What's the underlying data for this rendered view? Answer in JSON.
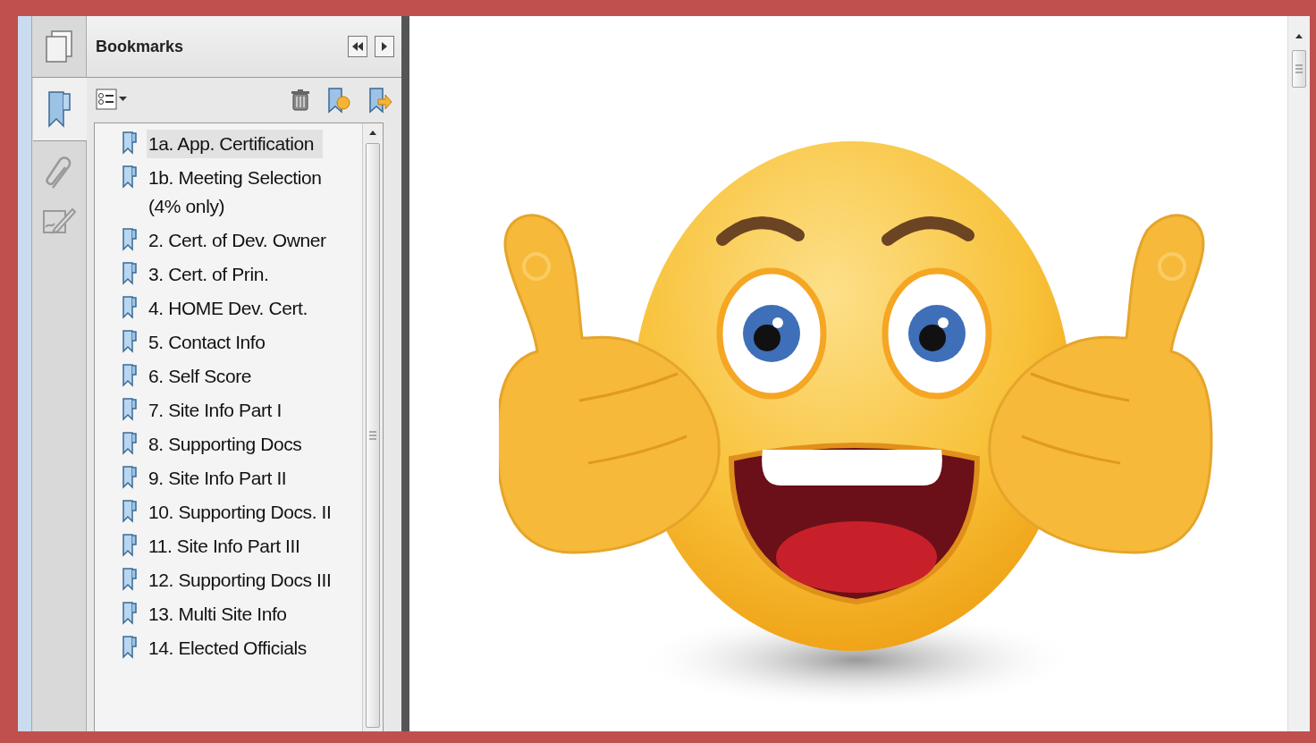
{
  "panel": {
    "title": "Bookmarks"
  },
  "bookmarks": [
    {
      "label": "1a. App. Certification",
      "selected": true
    },
    {
      "label": "1b. Meeting Selection (4% only)",
      "selected": false
    },
    {
      "label": "2. Cert. of Dev. Owner",
      "selected": false
    },
    {
      "label": "3. Cert. of Prin.",
      "selected": false
    },
    {
      "label": "4. HOME Dev. Cert.",
      "selected": false
    },
    {
      "label": "5. Contact Info",
      "selected": false
    },
    {
      "label": "6. Self Score",
      "selected": false
    },
    {
      "label": "7. Site Info Part I",
      "selected": false
    },
    {
      "label": "8. Supporting Docs",
      "selected": false
    },
    {
      "label": "9. Site Info Part II",
      "selected": false
    },
    {
      "label": "10. Supporting Docs. II",
      "selected": false
    },
    {
      "label": "11. Site Info Part III",
      "selected": false
    },
    {
      "label": "12. Supporting Docs III",
      "selected": false
    },
    {
      "label": "13. Multi Site Info",
      "selected": false
    },
    {
      "label": "14. Elected Officials",
      "selected": false
    }
  ]
}
